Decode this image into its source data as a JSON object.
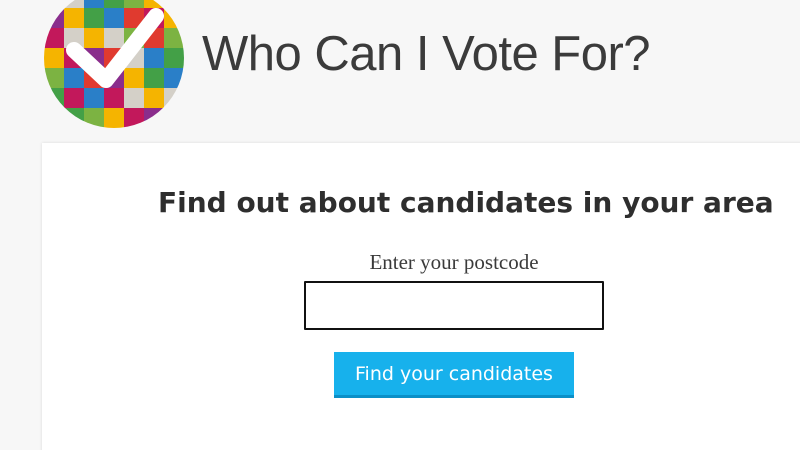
{
  "header": {
    "site_title": "Who Can I Vote For?",
    "logo_icon": "checkmark-mosaic-icon"
  },
  "search": {
    "heading": "Find out about candidates in your area",
    "postcode_label": "Enter your postcode",
    "postcode_value": "",
    "postcode_placeholder": "",
    "submit_label": "Find your candidates"
  },
  "colors": {
    "button_bg": "#17b1ec",
    "button_text": "#ffffff",
    "title_text": "#3b3b3b",
    "logo_palette": [
      "#e03a2f",
      "#f5b400",
      "#2a7fc8",
      "#8a2d8c",
      "#7cb342",
      "#d4d0c8",
      "#c2185b",
      "#43a047"
    ]
  }
}
